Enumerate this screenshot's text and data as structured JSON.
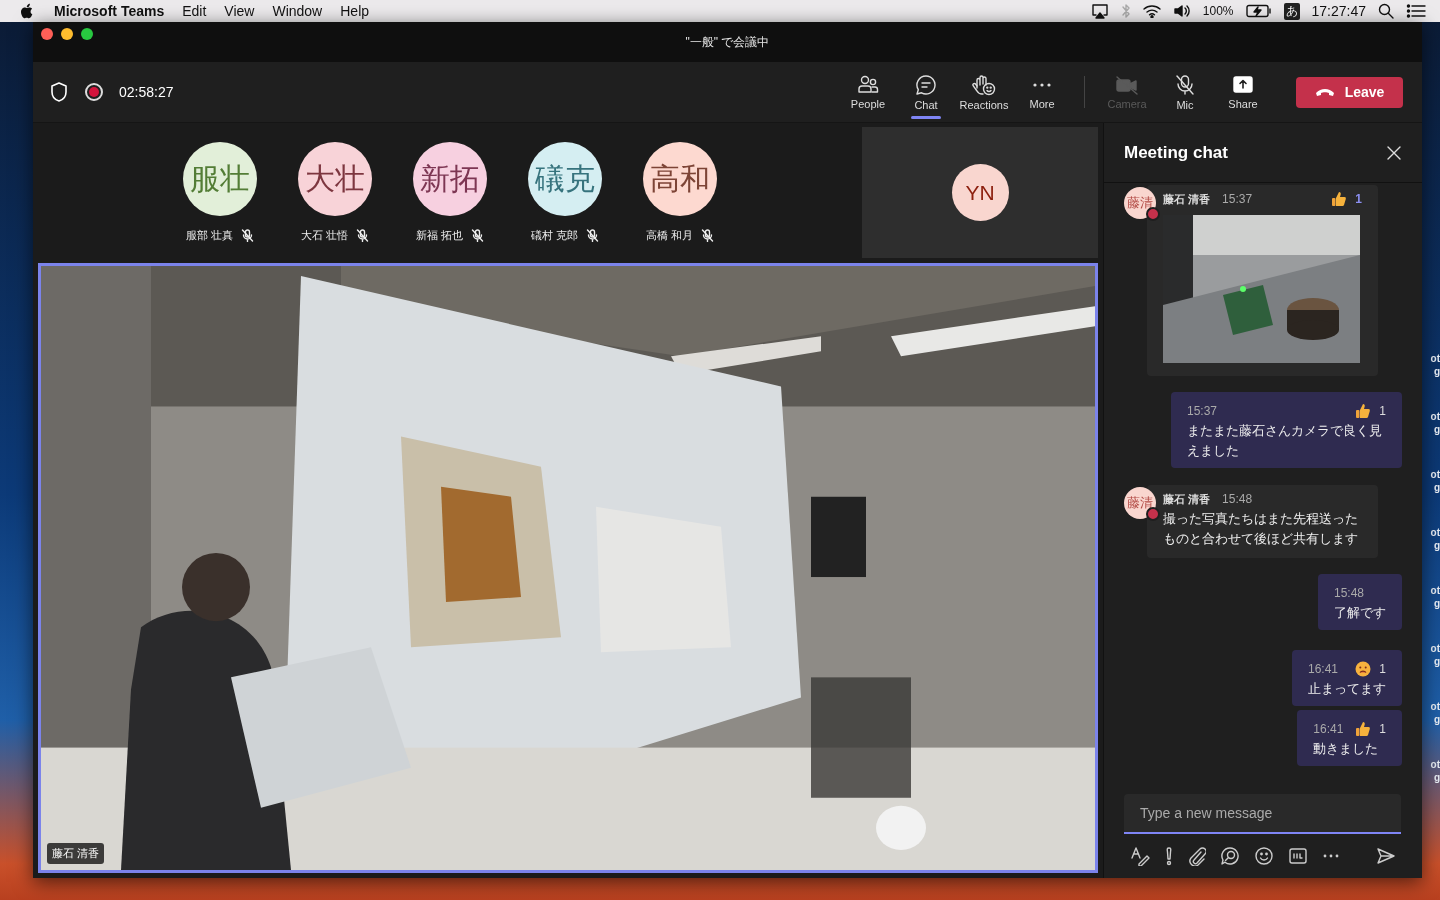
{
  "menubar": {
    "app": "Microsoft Teams",
    "menus": [
      "Edit",
      "View",
      "Window",
      "Help"
    ],
    "battery": "100%",
    "input_method": "あ",
    "clock": "17:27:47"
  },
  "window": {
    "title": "\"一般\" で会議中"
  },
  "toolbar": {
    "timer": "02:58:27",
    "recording": true,
    "buttons": [
      {
        "label": "People",
        "kind": "people",
        "selected": false,
        "disabled": false
      },
      {
        "label": "Chat",
        "kind": "chat",
        "selected": true,
        "disabled": false
      },
      {
        "label": "Reactions",
        "kind": "reactions",
        "selected": false,
        "disabled": false
      },
      {
        "label": "More",
        "kind": "more",
        "selected": false,
        "disabled": false
      },
      {
        "label": "Camera",
        "kind": "camera",
        "selected": false,
        "disabled": true
      },
      {
        "label": "Mic",
        "kind": "mic",
        "selected": false,
        "disabled": false
      },
      {
        "label": "Share",
        "kind": "share",
        "selected": false,
        "disabled": false
      }
    ],
    "leave": "Leave"
  },
  "participants": [
    {
      "initials": "服壮",
      "name": "服部 壮真",
      "color": "#e2efd9",
      "muted": true
    },
    {
      "initials": "大壮",
      "name": "大石 壮悟",
      "color": "#f8d3d8",
      "muted": true
    },
    {
      "initials": "新拓",
      "name": "新福 拓也",
      "color": "#f7d0e0",
      "muted": true
    },
    {
      "initials": "礒克",
      "name": "礒村 克郎",
      "color": "#d5eef2",
      "muted": true
    },
    {
      "initials": "高和",
      "name": "高橋 和月",
      "color": "#fdd9d0",
      "muted": true
    }
  ],
  "spotlight_tile": {
    "initials": "YN"
  },
  "video": {
    "kind": "picture",
    "name": "藤石 清香"
  },
  "chat": {
    "title": "Meeting chat",
    "messages": [
      {
        "kind": "received",
        "author": "藤石 清香",
        "initials": "藤清",
        "busy": true,
        "time": "15:37",
        "reaction": {
          "kind": "like",
          "count": "1",
          "mine": true
        }
      },
      {
        "kind": "sent",
        "time": "15:37",
        "text": "またまた藤石さんカメラで良く見えました",
        "reaction": {
          "kind": "like",
          "count": "1",
          "mine": false
        }
      },
      {
        "kind": "received",
        "author": "藤石 清香",
        "initials": "藤清",
        "busy": true,
        "time": "15:48",
        "text": "撮った写真たちはまた先程送ったものと合わせて後ほど共有します"
      },
      {
        "kind": "sent",
        "time": "15:48",
        "text": "了解です"
      },
      {
        "kind": "sent",
        "time": "16:41",
        "text": "止まってます",
        "reaction": {
          "kind": "sad",
          "count": "1",
          "mine": false
        }
      },
      {
        "kind": "sent",
        "time": "16:41",
        "text": "動きました",
        "reaction": {
          "kind": "like",
          "count": "1",
          "mine": false
        }
      }
    ],
    "placeholder": "Type a new message"
  },
  "desktop_labels": [
    {
      "lines": [
        "ot",
        "g"
      ]
    },
    {
      "lines": [
        "ot",
        "g"
      ]
    },
    {
      "lines": [
        "ot",
        "g"
      ]
    },
    {
      "lines": [
        "ot",
        "g"
      ]
    },
    {
      "lines": [
        "ot",
        "g"
      ]
    },
    {
      "lines": [
        "ot",
        "g"
      ]
    },
    {
      "lines": [
        "ot",
        "g"
      ]
    },
    {
      "lines": [
        "ot",
        "g"
      ]
    }
  ]
}
